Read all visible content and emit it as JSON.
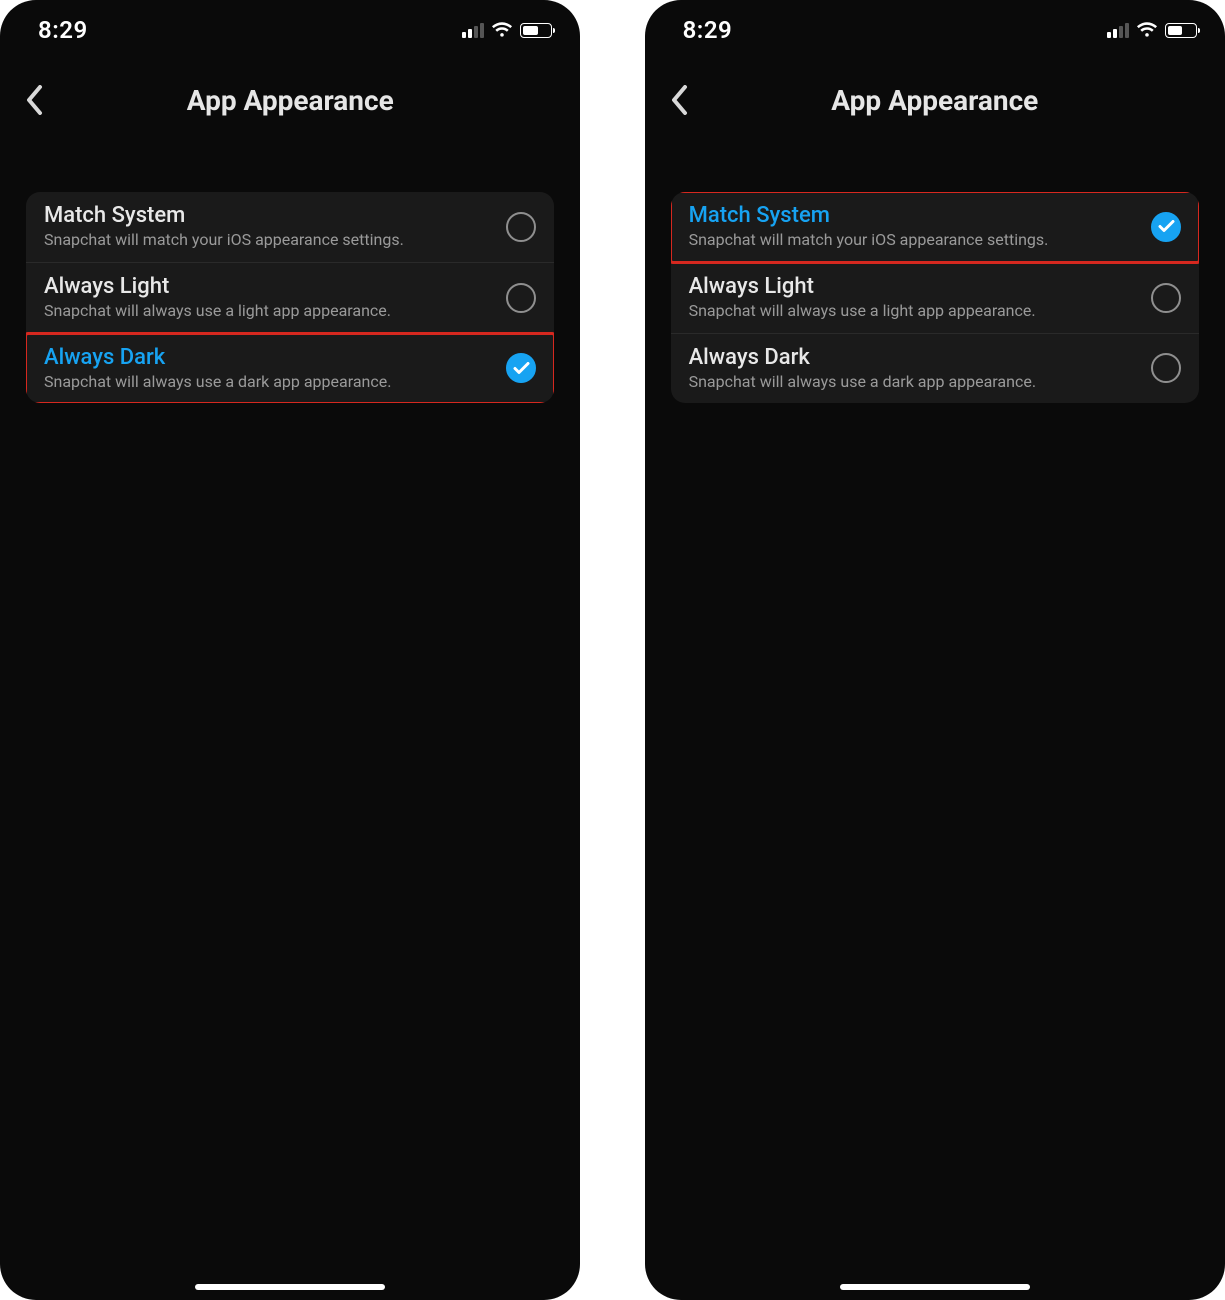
{
  "status": {
    "time": "8:29"
  },
  "header": {
    "title": "App Appearance"
  },
  "options": [
    {
      "title": "Match System",
      "subtitle": "Snapchat will match your iOS appearance settings."
    },
    {
      "title": "Always Light",
      "subtitle": "Snapchat will always use a light app appearance."
    },
    {
      "title": "Always Dark",
      "subtitle": "Snapchat will always use a dark app appearance."
    }
  ],
  "screens": {
    "left": {
      "selected_index": 2,
      "highlighted_index": 2
    },
    "right": {
      "selected_index": 0,
      "highlighted_index": 0
    }
  },
  "colors": {
    "accent": "#17a3f2",
    "highlight": "#d6281f"
  }
}
